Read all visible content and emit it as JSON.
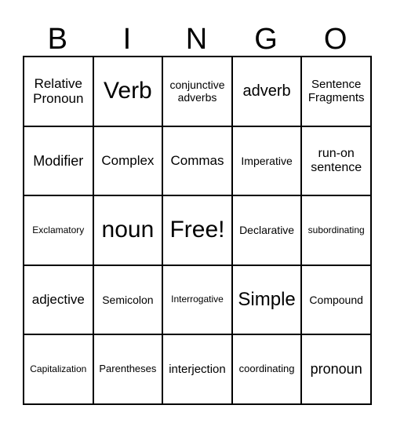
{
  "title_letters": [
    "B",
    "I",
    "N",
    "G",
    "O"
  ],
  "grid": [
    [
      "Relative Pronoun",
      "Verb",
      "conjunctive adverbs",
      "adverb",
      "Sentence Fragments"
    ],
    [
      "Modifier",
      "Complex",
      "Commas",
      "Imperative",
      "run-on sentence"
    ],
    [
      "Exclamatory",
      "noun",
      "Free!",
      "Declarative",
      "subordinating"
    ],
    [
      "adjective",
      "Semicolon",
      "Interrogative",
      "Simple",
      "Compound"
    ],
    [
      "Capitalization",
      "Parentheses",
      "interjection",
      "coordinating",
      "pronoun"
    ]
  ]
}
